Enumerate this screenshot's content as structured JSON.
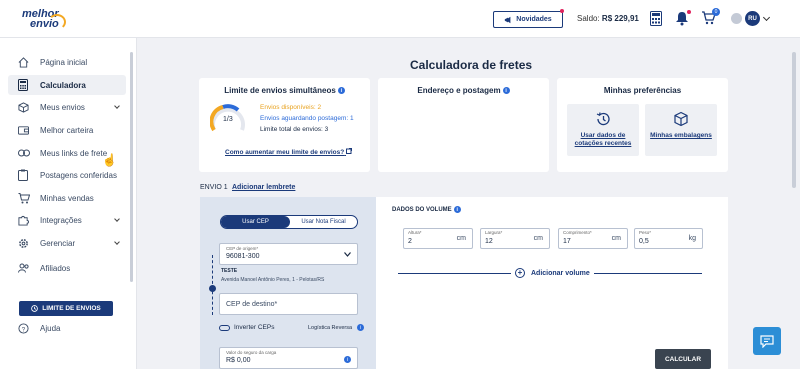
{
  "brand": {
    "logo_line1": "melhor",
    "logo_line2": "envio"
  },
  "topbar": {
    "news_label": "Novidades",
    "saldo_label": "Saldo:",
    "saldo_value": "R$ 229,91",
    "cart_count": "0",
    "avatar_initials": "RU"
  },
  "sidebar": {
    "items": [
      {
        "label": "Página inicial",
        "icon": "home-icon"
      },
      {
        "label": "Calculadora",
        "icon": "calculator-icon"
      },
      {
        "label": "Meus envios",
        "icon": "box-icon"
      },
      {
        "label": "Melhor carteira",
        "icon": "wallet-icon"
      },
      {
        "label": "Meus links de frete",
        "icon": "link-icon"
      },
      {
        "label": "Postagens conferidas",
        "icon": "clipboard-icon"
      },
      {
        "label": "Minhas vendas",
        "icon": "cart-icon"
      },
      {
        "label": "Integrações",
        "icon": "puzzle-icon"
      },
      {
        "label": "Gerenciar",
        "icon": "gear-icon"
      },
      {
        "label": "Afiliados",
        "icon": "users-icon"
      }
    ],
    "limit_button": "LIMITE DE ENVIOS",
    "help": "Ajuda"
  },
  "main": {
    "title": "Calculadora de fretes",
    "limit_card": {
      "title": "Limite de envios simultâneos",
      "gauge_text": "1/3",
      "gauge_fraction": 0.33,
      "available": "Envios disponíveis: 2",
      "waiting": "Envios aguardando postagem: 1",
      "total": "Limite total de envios: 3",
      "link": "Como aumentar meu limite de envios?"
    },
    "address_card": {
      "title": "Endereço e postagem"
    },
    "prefs_card": {
      "title": "Minhas preferências",
      "option1": "Usar dados de cotações recentes",
      "option2": "Minhas embalagens"
    },
    "envio": {
      "tab": "ENVIO 1",
      "reminder": "Adicionar lembrete"
    },
    "form": {
      "toggle_cep": "Usar CEP",
      "toggle_nf": "Usar Nota Fiscal",
      "origin_label": "CEP de origem*",
      "origin_value": "96081-300",
      "addr_title": "TESTE",
      "addr_text": "Avenida Manoel Antônio Peres, 1 - Pelotas/RS",
      "dest_placeholder": "CEP de destino*",
      "swap_label": "Inverter CEPs",
      "reverse_label": "Logística Reversa",
      "insurance_label": "Valor do seguro da carga",
      "insurance_value": "R$ 0,00"
    },
    "volume": {
      "title": "DADOS DO VOLUME",
      "fields": [
        {
          "label": "Altura*",
          "value": "2",
          "unit": "cm"
        },
        {
          "label": "Largura*",
          "value": "12",
          "unit": "cm"
        },
        {
          "label": "Comprimento*",
          "value": "17",
          "unit": "cm"
        },
        {
          "label": "Peso*",
          "value": "0,5",
          "unit": "kg"
        }
      ],
      "add_volume": "Adicionar volume"
    },
    "calculate": "CALCULAR"
  },
  "colors": {
    "primary": "#1b3a7a",
    "accent": "#f3a823",
    "info": "#2c6bd8"
  }
}
